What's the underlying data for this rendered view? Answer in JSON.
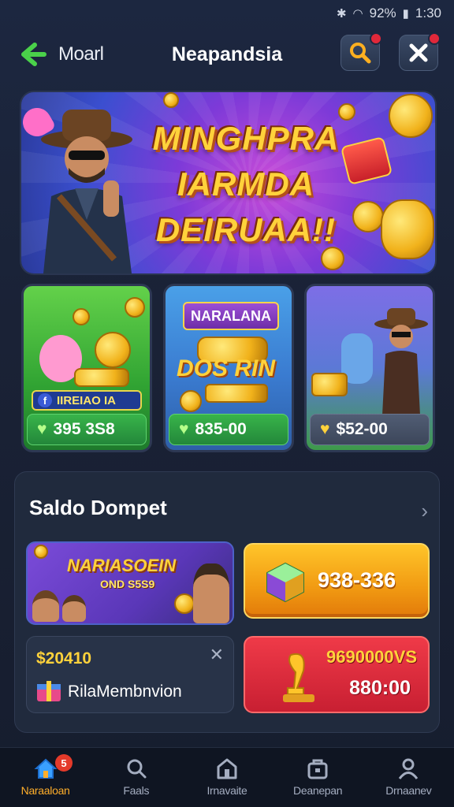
{
  "status_bar": {
    "battery": "92%",
    "time": "1:30",
    "icons": [
      "bluetooth-icon",
      "wifi-icon",
      "battery-icon"
    ]
  },
  "header": {
    "back_label": "Moarl",
    "title": "Neapandsia",
    "buttons": [
      "search-icon",
      "close-icon"
    ]
  },
  "banner": {
    "title_lines": [
      "MINGHPRA",
      "IARMDA",
      "DEIRUAA!!"
    ]
  },
  "cards": [
    {
      "tag": "IIREIAO IA",
      "price": "395 3S8"
    },
    {
      "badge": "NARALANA",
      "word": "DOS RIN",
      "price": "835-00"
    },
    {
      "price": "$52-00"
    }
  ],
  "wallet": {
    "title": "Saldo Dompet",
    "promo": {
      "word": "NARIASOEIN",
      "sub": "OND S5S9"
    },
    "orange_value": "938-336",
    "dark": {
      "amount": "$20410",
      "label": "RilaMembnvion"
    },
    "red": {
      "top": "9690000VS",
      "bottom": "880:00"
    }
  },
  "bottom_nav": [
    {
      "label": "Naraaloan",
      "icon": "home-icon",
      "badge": "5",
      "active": true
    },
    {
      "label": "Faals",
      "icon": "search-icon"
    },
    {
      "label": "Irnavaite",
      "icon": "store-icon"
    },
    {
      "label": "Deanepan",
      "icon": "wallet-icon"
    },
    {
      "label": "Drnaanev",
      "icon": "profile-icon"
    }
  ],
  "colors": {
    "accent": "#ffae2a",
    "green": "#31a433",
    "red": "#e0283a",
    "bg": "#1c2740"
  }
}
